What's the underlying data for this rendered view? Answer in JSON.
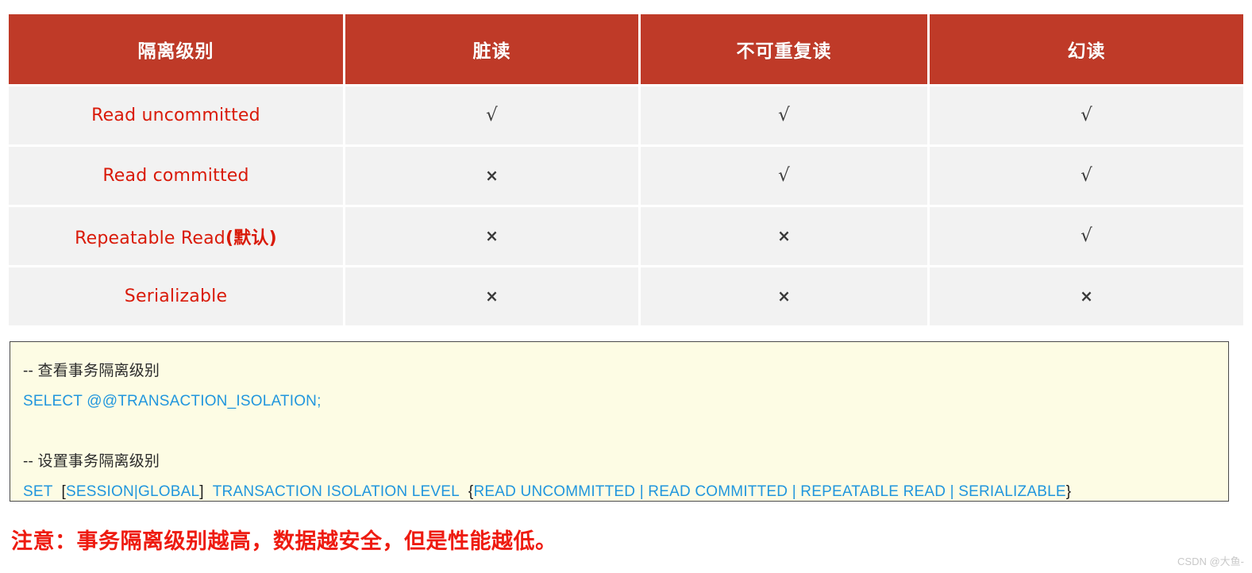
{
  "table": {
    "columns": [
      "隔离级别",
      "脏读",
      "不可重复读",
      "幻读"
    ],
    "rows": [
      {
        "level_en": "Read uncommitted",
        "level_cn": "",
        "dirty": "√",
        "nonrepeatable": "√",
        "phantom": "√"
      },
      {
        "level_en": "Read committed",
        "level_cn": "",
        "dirty": "×",
        "nonrepeatable": "√",
        "phantom": "√"
      },
      {
        "level_en": "Repeatable Read",
        "level_cn": "(默认)",
        "dirty": "×",
        "nonrepeatable": "×",
        "phantom": "√"
      },
      {
        "level_en": "Serializable",
        "level_cn": "",
        "dirty": "×",
        "nonrepeatable": "×",
        "phantom": "×"
      }
    ]
  },
  "code": {
    "comment1": "-- 查看事务隔离级别",
    "statement1": "SELECT @@TRANSACTION_ISOLATION;",
    "comment2": "-- 设置事务隔离级别",
    "statement2_parts": {
      "set": "SET",
      "bracket_open": "[",
      "session_global": "SESSION|GLOBAL",
      "bracket_close": "]",
      "transaction_isolation_level": "TRANSACTION  ISOLATION  LEVEL",
      "brace_open": "{",
      "options": "READ UNCOMMITTED | READ COMMITTED | REPEATABLE READ | SERIALIZABLE",
      "brace_close": "}"
    }
  },
  "note": {
    "text": "注意：事务隔离级别越高，数据越安全，但是性能越低。"
  },
  "watermark": {
    "text": "CSDN @大鱼-"
  },
  "colors": {
    "header_red": "#bf3a28",
    "level_text_red": "#d91a09",
    "note_red": "#ee1b10",
    "sql_blue": "#2196dd",
    "code_bg": "#fdfce4",
    "cell_bg": "#f2f2f2"
  }
}
